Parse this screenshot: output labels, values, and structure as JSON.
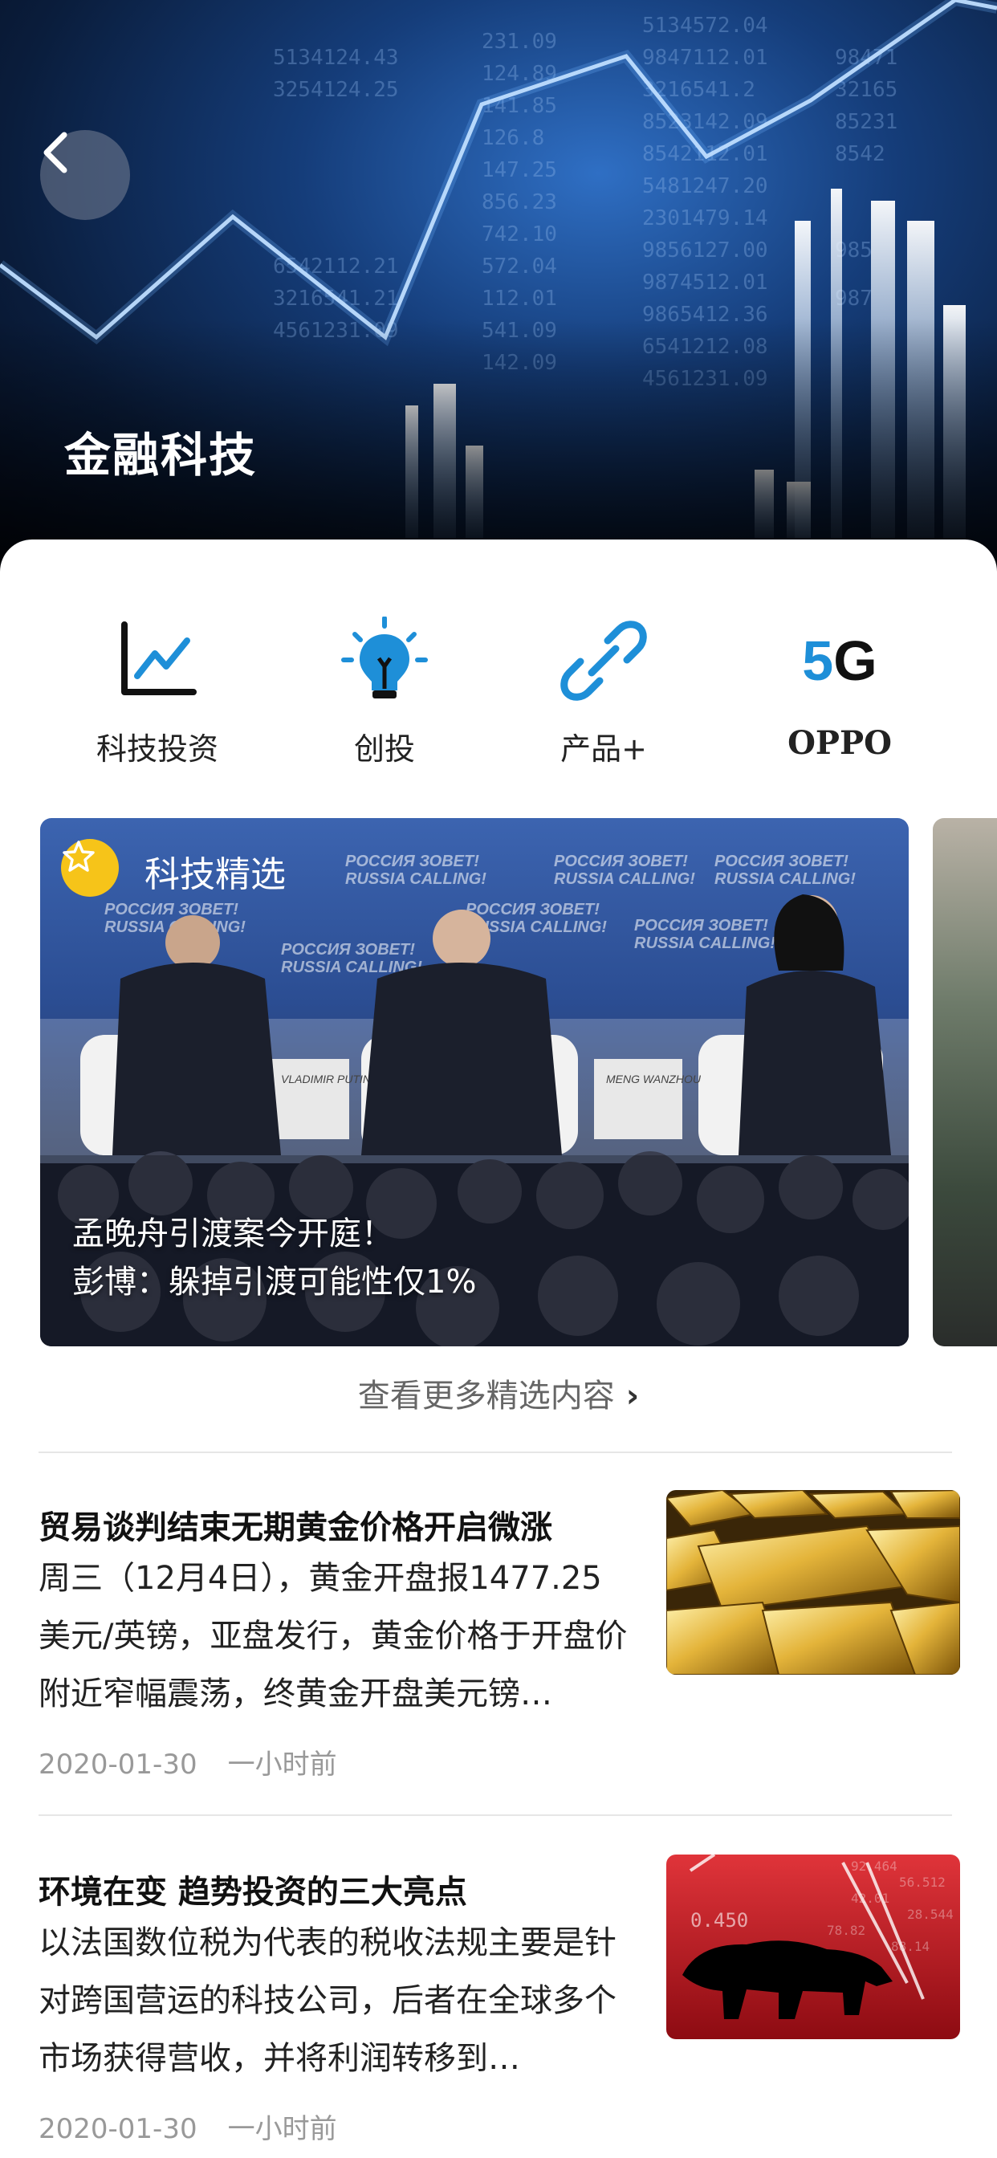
{
  "hero": {
    "title": "金融科技"
  },
  "categories": [
    {
      "label": "科技投资",
      "icon": "trend-chart-icon"
    },
    {
      "label": "创投",
      "icon": "lightbulb-icon"
    },
    {
      "label": "产品+",
      "icon": "link-icon"
    },
    {
      "label": "OPPO",
      "icon": "5g-icon",
      "icon_text_a": "5",
      "icon_text_b": "G"
    }
  ],
  "featured": {
    "badge_label": "科技精选",
    "caption_line1": "孟晚舟引渡案今开庭！",
    "caption_line2": "彭博：躲掉引渡可能性仅1%",
    "banner_text_1": "РОССИЯ ЗОВЕТ!",
    "banner_text_2": "RUSSIA CALLING!",
    "name_card_1": "VLADIMIR PUTIN",
    "name_card_2": "MENG WANZHOU"
  },
  "more_link": "查看更多精选内容",
  "news": [
    {
      "title": "贸易谈判结束无期黄金价格开启微涨",
      "body": "周三（12月4日），黄金开盘报1477.25美元/英镑，亚盘发行，黄金价格于开盘价附近窄幅震荡，终黄金开盘美元镑…",
      "date": "2020-01-30",
      "time": "一小时前",
      "thumb": "gold-bars"
    },
    {
      "title": "环境在变 趋势投资的三大亮点",
      "body": "以法国数位税为代表的税收法规主要是针对跨国营运的科技公司，后者在全球多个市场获得营收，并将利润转移到…",
      "date": "2020-01-30",
      "time": "一小时前",
      "thumb": "bear-market"
    }
  ],
  "colors": {
    "accent": "#1e8fd8",
    "badge": "#f6c419"
  }
}
